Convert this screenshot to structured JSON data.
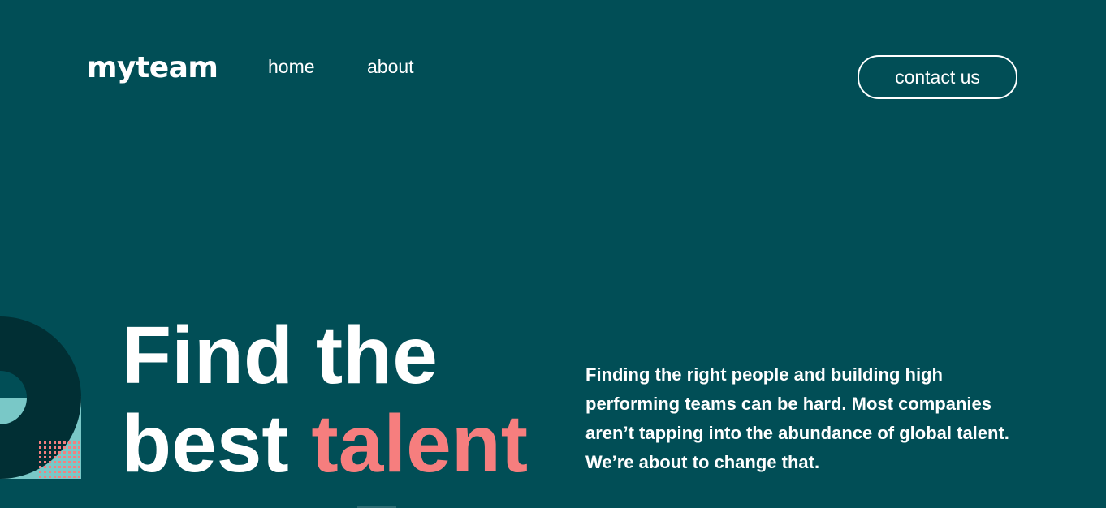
{
  "brand": {
    "logo": "myteam"
  },
  "nav": {
    "items": [
      {
        "label": "home"
      },
      {
        "label": "about"
      }
    ],
    "cta_label": "contact us"
  },
  "hero": {
    "title_line1": "Find the",
    "title_line2_start": "best ",
    "title_accent": "talent",
    "description": "Finding the right people and building high performing teams can be hard. Most companies aren’t tapping into the abundance of global talent. We’re about to change that."
  },
  "colors": {
    "background": "#014e56",
    "accent": "#f67e7e",
    "decor_dark": "#012f34",
    "decor_light": "#79c8c7",
    "text": "#ffffff"
  }
}
